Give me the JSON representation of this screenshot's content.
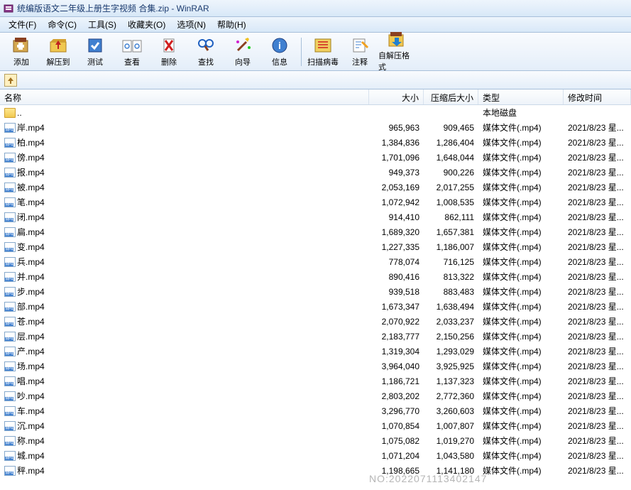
{
  "window": {
    "title": "统编版语文二年级上册生字视频 合集.zip - WinRAR"
  },
  "menu": {
    "file": "文件(F)",
    "cmd": "命令(C)",
    "tool": "工具(S)",
    "fav": "收藏夹(O)",
    "opt": "选项(N)",
    "help": "帮助(H)"
  },
  "toolbar": {
    "add": "添加",
    "extract": "解压到",
    "test": "测试",
    "view": "查看",
    "delete": "删除",
    "find": "查找",
    "wizard": "向导",
    "info": "信息",
    "scan": "扫描病毒",
    "comment": "注释",
    "sfx": "自解压格式"
  },
  "columns": {
    "name": "名称",
    "size": "大小",
    "packed": "压缩后大小",
    "type": "类型",
    "date": "修改时间"
  },
  "parent": {
    "name": "..",
    "type": "本地磁盘"
  },
  "files": [
    {
      "name": "岸.mp4",
      "size": "965,963",
      "packed": "909,465",
      "type": "媒体文件(.mp4)",
      "date": "2021/8/23 星..."
    },
    {
      "name": "柏.mp4",
      "size": "1,384,836",
      "packed": "1,286,404",
      "type": "媒体文件(.mp4)",
      "date": "2021/8/23 星..."
    },
    {
      "name": "傍.mp4",
      "size": "1,701,096",
      "packed": "1,648,044",
      "type": "媒体文件(.mp4)",
      "date": "2021/8/23 星..."
    },
    {
      "name": "报.mp4",
      "size": "949,373",
      "packed": "900,226",
      "type": "媒体文件(.mp4)",
      "date": "2021/8/23 星..."
    },
    {
      "name": "被.mp4",
      "size": "2,053,169",
      "packed": "2,017,255",
      "type": "媒体文件(.mp4)",
      "date": "2021/8/23 星..."
    },
    {
      "name": "笔.mp4",
      "size": "1,072,942",
      "packed": "1,008,535",
      "type": "媒体文件(.mp4)",
      "date": "2021/8/23 星..."
    },
    {
      "name": "闭.mp4",
      "size": "914,410",
      "packed": "862,111",
      "type": "媒体文件(.mp4)",
      "date": "2021/8/23 星..."
    },
    {
      "name": "扁.mp4",
      "size": "1,689,320",
      "packed": "1,657,381",
      "type": "媒体文件(.mp4)",
      "date": "2021/8/23 星..."
    },
    {
      "name": "变.mp4",
      "size": "1,227,335",
      "packed": "1,186,007",
      "type": "媒体文件(.mp4)",
      "date": "2021/8/23 星..."
    },
    {
      "name": "兵.mp4",
      "size": "778,074",
      "packed": "716,125",
      "type": "媒体文件(.mp4)",
      "date": "2021/8/23 星..."
    },
    {
      "name": "并.mp4",
      "size": "890,416",
      "packed": "813,322",
      "type": "媒体文件(.mp4)",
      "date": "2021/8/23 星..."
    },
    {
      "name": "步.mp4",
      "size": "939,518",
      "packed": "883,483",
      "type": "媒体文件(.mp4)",
      "date": "2021/8/23 星..."
    },
    {
      "name": "部.mp4",
      "size": "1,673,347",
      "packed": "1,638,494",
      "type": "媒体文件(.mp4)",
      "date": "2021/8/23 星..."
    },
    {
      "name": "苍.mp4",
      "size": "2,070,922",
      "packed": "2,033,237",
      "type": "媒体文件(.mp4)",
      "date": "2021/8/23 星..."
    },
    {
      "name": "层.mp4",
      "size": "2,183,777",
      "packed": "2,150,256",
      "type": "媒体文件(.mp4)",
      "date": "2021/8/23 星..."
    },
    {
      "name": "产.mp4",
      "size": "1,319,304",
      "packed": "1,293,029",
      "type": "媒体文件(.mp4)",
      "date": "2021/8/23 星..."
    },
    {
      "name": "场.mp4",
      "size": "3,964,040",
      "packed": "3,925,925",
      "type": "媒体文件(.mp4)",
      "date": "2021/8/23 星..."
    },
    {
      "name": "唱.mp4",
      "size": "1,186,721",
      "packed": "1,137,323",
      "type": "媒体文件(.mp4)",
      "date": "2021/8/23 星..."
    },
    {
      "name": "吵.mp4",
      "size": "2,803,202",
      "packed": "2,772,360",
      "type": "媒体文件(.mp4)",
      "date": "2021/8/23 星..."
    },
    {
      "name": "车.mp4",
      "size": "3,296,770",
      "packed": "3,260,603",
      "type": "媒体文件(.mp4)",
      "date": "2021/8/23 星..."
    },
    {
      "name": "沉.mp4",
      "size": "1,070,854",
      "packed": "1,007,807",
      "type": "媒体文件(.mp4)",
      "date": "2021/8/23 星..."
    },
    {
      "name": "称.mp4",
      "size": "1,075,082",
      "packed": "1,019,270",
      "type": "媒体文件(.mp4)",
      "date": "2021/8/23 星..."
    },
    {
      "name": "城.mp4",
      "size": "1,071,204",
      "packed": "1,043,580",
      "type": "媒体文件(.mp4)",
      "date": "2021/8/23 星..."
    },
    {
      "name": "秤.mp4",
      "size": "1,198,665",
      "packed": "1,141,180",
      "type": "媒体文件(.mp4)",
      "date": "2021/8/23 星..."
    }
  ],
  "watermark": "NO:2022071113402147"
}
